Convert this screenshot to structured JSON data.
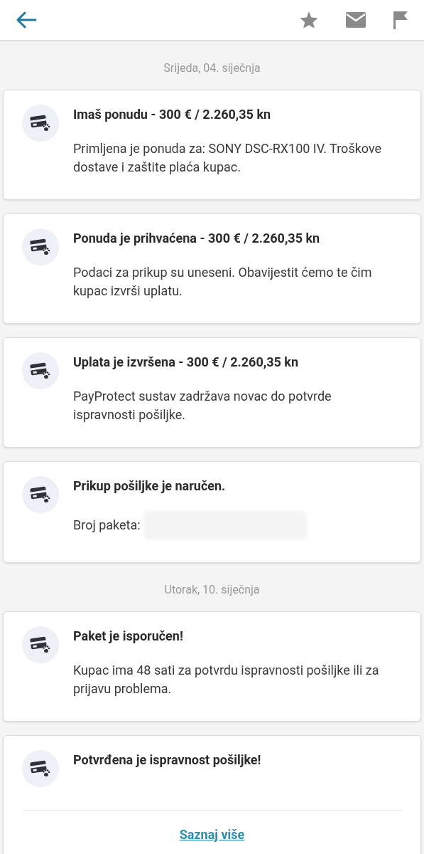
{
  "sections": [
    {
      "date": "Srijeda, 04. siječnja",
      "cards": [
        {
          "title": "Imaš ponudu - 300 € / 2.260,35 kn",
          "body": "Primljena je ponuda za: SONY DSC-RX100 IV. Troškove dostave i zaštite plaća kupac."
        },
        {
          "title": "Ponuda je prihvaćena - 300 € / 2.260,35 kn",
          "body": "Podaci za prikup su uneseni. Obavijestit ćemo te čim kupac izvrši uplatu."
        },
        {
          "title": "Uplata je izvršena - 300 € / 2.260,35 kn",
          "body": "PayProtect sustav zadržava novac do potvrde ispravnosti pošiljke."
        },
        {
          "title": "Prikup pošiljke je naručen.",
          "body": "Broj paketa:",
          "redacted": true
        }
      ]
    },
    {
      "date": "Utorak, 10. siječnja",
      "cards": [
        {
          "title": "Paket je isporučen!",
          "body": "Kupac ima 48 sati za potvrdu ispravnosti pošiljke ili za prijavu problema."
        },
        {
          "title": "Potvrđena je ispravnost pošiljke!",
          "link": "Saznaj više"
        }
      ]
    }
  ]
}
